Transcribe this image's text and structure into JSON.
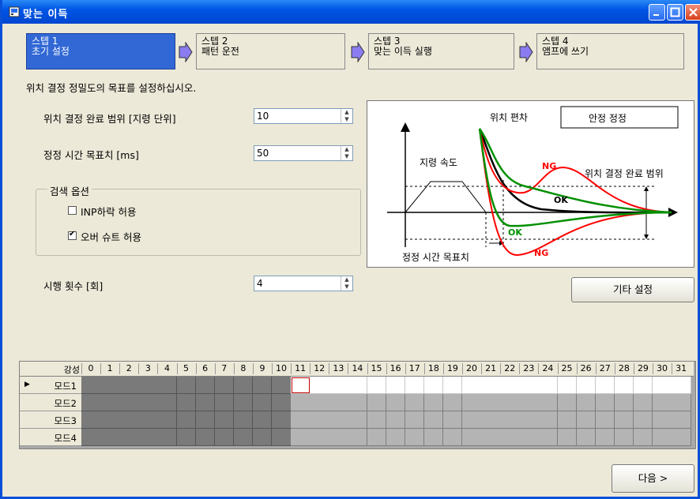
{
  "window": {
    "title": "맞는 이득",
    "icon": "app-icon"
  },
  "steps": [
    {
      "line1": "스텝 1",
      "line2": "초기 설정",
      "active": true
    },
    {
      "line1": "스텝 2",
      "line2": "패턴 운전",
      "active": false
    },
    {
      "line1": "스텝 3",
      "line2": "맞는 이득 실행",
      "active": false
    },
    {
      "line1": "스텝 4",
      "line2": "앰프에 쓰기",
      "active": false
    }
  ],
  "instruction": "위치 결정 정밀도의 목표를 설정하십시오.",
  "fields": {
    "inp_range": {
      "label": "위치 결정 완료 범위 [지령 단위]",
      "value": "10"
    },
    "settle_time": {
      "label": "정정 시간 목표치 [ms]",
      "value": "50"
    },
    "trials": {
      "label": "시행 횟수 [회]",
      "value": "4"
    }
  },
  "search_options": {
    "title": "검색 옵션",
    "inp_drop": {
      "label": "INP하락 허용",
      "checked": false
    },
    "overshoot": {
      "label": "오버 슈트 허용",
      "checked": true
    }
  },
  "diagram": {
    "pos_dev": "위치 편차",
    "stable": "안정 정정",
    "cmd_speed": "지령 속도",
    "inp_range": "위치 결정 완료 범위",
    "settle_target": "정정 시간 목표치",
    "ng": "NG",
    "ok": "OK"
  },
  "buttons": {
    "other_settings": "기타 설정",
    "next": "다음 >"
  },
  "grid": {
    "corner": "강성",
    "columns": [
      "0",
      "1",
      "2",
      "3",
      "4",
      "5",
      "6",
      "7",
      "8",
      "9",
      "10",
      "11",
      "12",
      "13",
      "14",
      "15",
      "16",
      "17",
      "18",
      "19",
      "20",
      "21",
      "22",
      "23",
      "24",
      "25",
      "26",
      "27",
      "28",
      "29",
      "30",
      "31"
    ],
    "rows": [
      {
        "label": "모드1",
        "current": true,
        "dark_upto": 10,
        "selected": 11,
        "white_from": 11
      },
      {
        "label": "모드2",
        "current": false,
        "dark_upto": 10
      },
      {
        "label": "모드3",
        "current": false,
        "dark_upto": 10
      },
      {
        "label": "모드4",
        "current": false,
        "dark_upto": 10
      }
    ]
  },
  "colors": {
    "active_step": "#3168d5",
    "step_arrow": "#8a7cf0",
    "ng": "#e00000",
    "ok_black": "#000000",
    "ok_green": "#009000"
  }
}
